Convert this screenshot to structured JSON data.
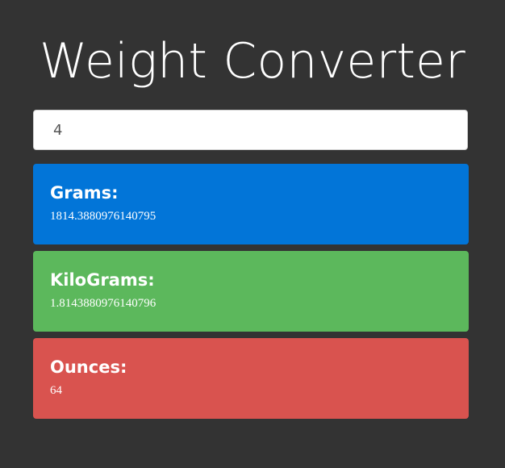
{
  "title": "Weight Converter",
  "input": {
    "value": "4"
  },
  "results": {
    "grams": {
      "label": "Grams:",
      "value": "1814.3880976140795",
      "color": "#0275d8"
    },
    "kilograms": {
      "label": "KiloGrams:",
      "value": "1.8143880976140796",
      "color": "#5cb85c"
    },
    "ounces": {
      "label": "Ounces:",
      "value": "64",
      "color": "#d9534f"
    }
  },
  "colors": {
    "background": "#333333"
  }
}
